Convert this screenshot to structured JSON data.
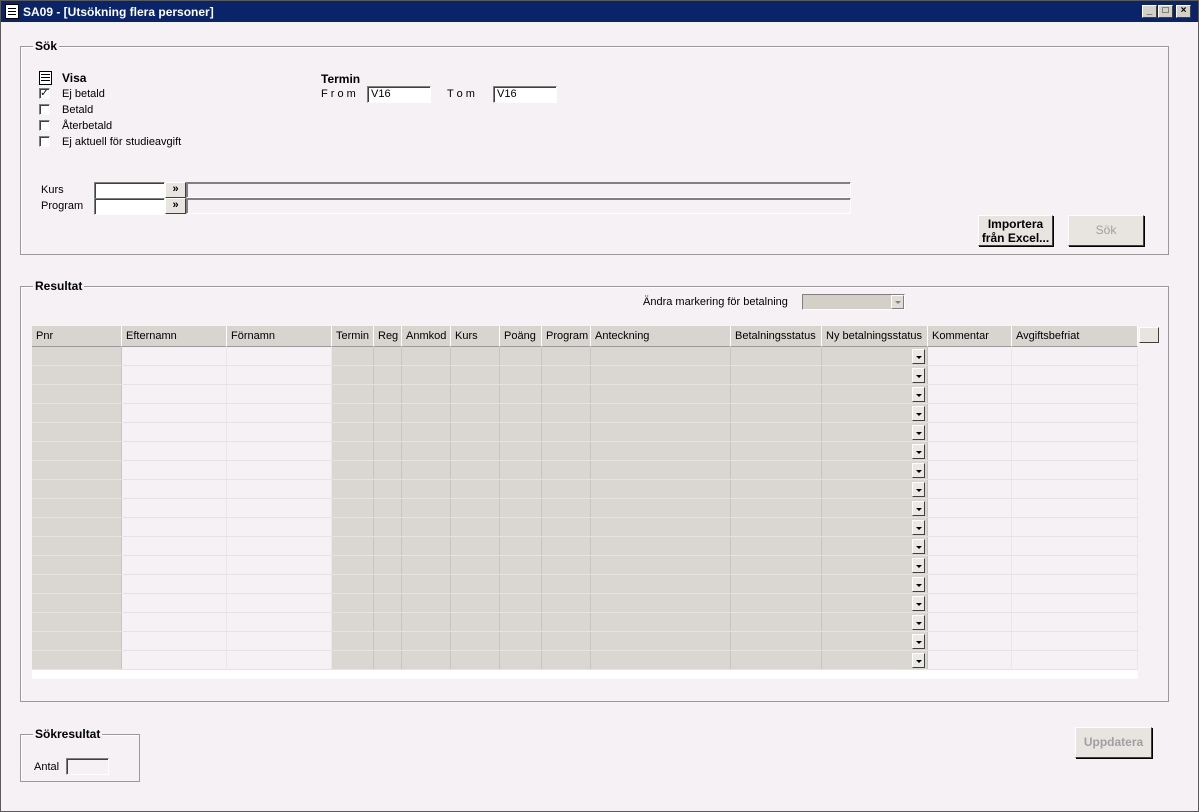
{
  "window": {
    "title": "SA09 - [Utsökning flera personer]"
  },
  "search": {
    "group_label": "Sök",
    "show_heading": "Visa",
    "checkboxes": [
      {
        "label": "Ej betald",
        "checked": true
      },
      {
        "label": "Betald",
        "checked": false
      },
      {
        "label": "Återbetald",
        "checked": false
      },
      {
        "label": "Ej aktuell för studieavgift",
        "checked": false
      }
    ],
    "term_heading": "Termin",
    "from_label": "F r o m",
    "from_value": "V16",
    "to_label": "T o m",
    "to_value": "V16",
    "course_label": "Kurs",
    "program_label": "Program",
    "arrow_label": "»",
    "import_button": "Importera från Excel...",
    "search_button": "Sök"
  },
  "result": {
    "group_label": "Resultat",
    "mark_label": "Ändra markering för betalning",
    "columns": [
      "Pnr",
      "Efternamn",
      "Förnamn",
      "Termin",
      "Reg",
      "Anmkod",
      "Kurs",
      "Poäng",
      "Program",
      "Anteckning",
      "Betalningsstatus",
      "Ny betalningsstatus",
      "Kommentar",
      "Avgiftsbefriat"
    ],
    "row_count": 17
  },
  "summary": {
    "group_label": "Sökresultat",
    "count_label": "Antal",
    "count_value": ""
  },
  "update_button": "Uppdatera"
}
